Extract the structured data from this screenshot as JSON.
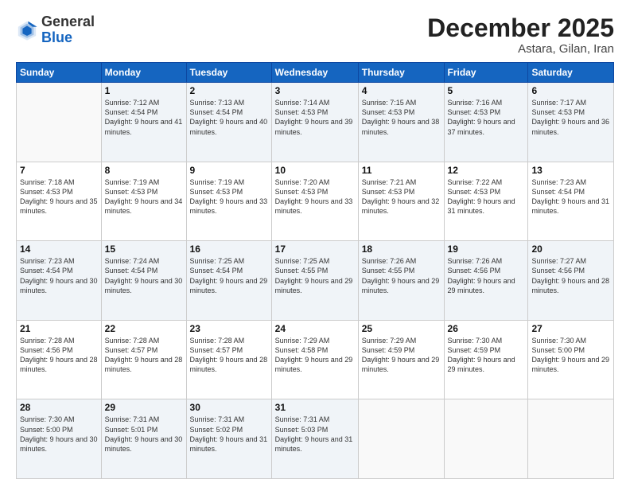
{
  "logo": {
    "general": "General",
    "blue": "Blue"
  },
  "header": {
    "month": "December 2025",
    "location": "Astara, Gilan, Iran"
  },
  "weekdays": [
    "Sunday",
    "Monday",
    "Tuesday",
    "Wednesday",
    "Thursday",
    "Friday",
    "Saturday"
  ],
  "weeks": [
    [
      {
        "day": "",
        "info": ""
      },
      {
        "day": "1",
        "info": "Sunrise: 7:12 AM\nSunset: 4:54 PM\nDaylight: 9 hours\nand 41 minutes."
      },
      {
        "day": "2",
        "info": "Sunrise: 7:13 AM\nSunset: 4:54 PM\nDaylight: 9 hours\nand 40 minutes."
      },
      {
        "day": "3",
        "info": "Sunrise: 7:14 AM\nSunset: 4:53 PM\nDaylight: 9 hours\nand 39 minutes."
      },
      {
        "day": "4",
        "info": "Sunrise: 7:15 AM\nSunset: 4:53 PM\nDaylight: 9 hours\nand 38 minutes."
      },
      {
        "day": "5",
        "info": "Sunrise: 7:16 AM\nSunset: 4:53 PM\nDaylight: 9 hours\nand 37 minutes."
      },
      {
        "day": "6",
        "info": "Sunrise: 7:17 AM\nSunset: 4:53 PM\nDaylight: 9 hours\nand 36 minutes."
      }
    ],
    [
      {
        "day": "7",
        "info": "Sunrise: 7:18 AM\nSunset: 4:53 PM\nDaylight: 9 hours\nand 35 minutes."
      },
      {
        "day": "8",
        "info": "Sunrise: 7:19 AM\nSunset: 4:53 PM\nDaylight: 9 hours\nand 34 minutes."
      },
      {
        "day": "9",
        "info": "Sunrise: 7:19 AM\nSunset: 4:53 PM\nDaylight: 9 hours\nand 33 minutes."
      },
      {
        "day": "10",
        "info": "Sunrise: 7:20 AM\nSunset: 4:53 PM\nDaylight: 9 hours\nand 33 minutes."
      },
      {
        "day": "11",
        "info": "Sunrise: 7:21 AM\nSunset: 4:53 PM\nDaylight: 9 hours\nand 32 minutes."
      },
      {
        "day": "12",
        "info": "Sunrise: 7:22 AM\nSunset: 4:53 PM\nDaylight: 9 hours\nand 31 minutes."
      },
      {
        "day": "13",
        "info": "Sunrise: 7:23 AM\nSunset: 4:54 PM\nDaylight: 9 hours\nand 31 minutes."
      }
    ],
    [
      {
        "day": "14",
        "info": "Sunrise: 7:23 AM\nSunset: 4:54 PM\nDaylight: 9 hours\nand 30 minutes."
      },
      {
        "day": "15",
        "info": "Sunrise: 7:24 AM\nSunset: 4:54 PM\nDaylight: 9 hours\nand 30 minutes."
      },
      {
        "day": "16",
        "info": "Sunrise: 7:25 AM\nSunset: 4:54 PM\nDaylight: 9 hours\nand 29 minutes."
      },
      {
        "day": "17",
        "info": "Sunrise: 7:25 AM\nSunset: 4:55 PM\nDaylight: 9 hours\nand 29 minutes."
      },
      {
        "day": "18",
        "info": "Sunrise: 7:26 AM\nSunset: 4:55 PM\nDaylight: 9 hours\nand 29 minutes."
      },
      {
        "day": "19",
        "info": "Sunrise: 7:26 AM\nSunset: 4:56 PM\nDaylight: 9 hours\nand 29 minutes."
      },
      {
        "day": "20",
        "info": "Sunrise: 7:27 AM\nSunset: 4:56 PM\nDaylight: 9 hours\nand 28 minutes."
      }
    ],
    [
      {
        "day": "21",
        "info": "Sunrise: 7:28 AM\nSunset: 4:56 PM\nDaylight: 9 hours\nand 28 minutes."
      },
      {
        "day": "22",
        "info": "Sunrise: 7:28 AM\nSunset: 4:57 PM\nDaylight: 9 hours\nand 28 minutes."
      },
      {
        "day": "23",
        "info": "Sunrise: 7:28 AM\nSunset: 4:57 PM\nDaylight: 9 hours\nand 28 minutes."
      },
      {
        "day": "24",
        "info": "Sunrise: 7:29 AM\nSunset: 4:58 PM\nDaylight: 9 hours\nand 29 minutes."
      },
      {
        "day": "25",
        "info": "Sunrise: 7:29 AM\nSunset: 4:59 PM\nDaylight: 9 hours\nand 29 minutes."
      },
      {
        "day": "26",
        "info": "Sunrise: 7:30 AM\nSunset: 4:59 PM\nDaylight: 9 hours\nand 29 minutes."
      },
      {
        "day": "27",
        "info": "Sunrise: 7:30 AM\nSunset: 5:00 PM\nDaylight: 9 hours\nand 29 minutes."
      }
    ],
    [
      {
        "day": "28",
        "info": "Sunrise: 7:30 AM\nSunset: 5:00 PM\nDaylight: 9 hours\nand 30 minutes."
      },
      {
        "day": "29",
        "info": "Sunrise: 7:31 AM\nSunset: 5:01 PM\nDaylight: 9 hours\nand 30 minutes."
      },
      {
        "day": "30",
        "info": "Sunrise: 7:31 AM\nSunset: 5:02 PM\nDaylight: 9 hours\nand 31 minutes."
      },
      {
        "day": "31",
        "info": "Sunrise: 7:31 AM\nSunset: 5:03 PM\nDaylight: 9 hours\nand 31 minutes."
      },
      {
        "day": "",
        "info": ""
      },
      {
        "day": "",
        "info": ""
      },
      {
        "day": "",
        "info": ""
      }
    ]
  ]
}
